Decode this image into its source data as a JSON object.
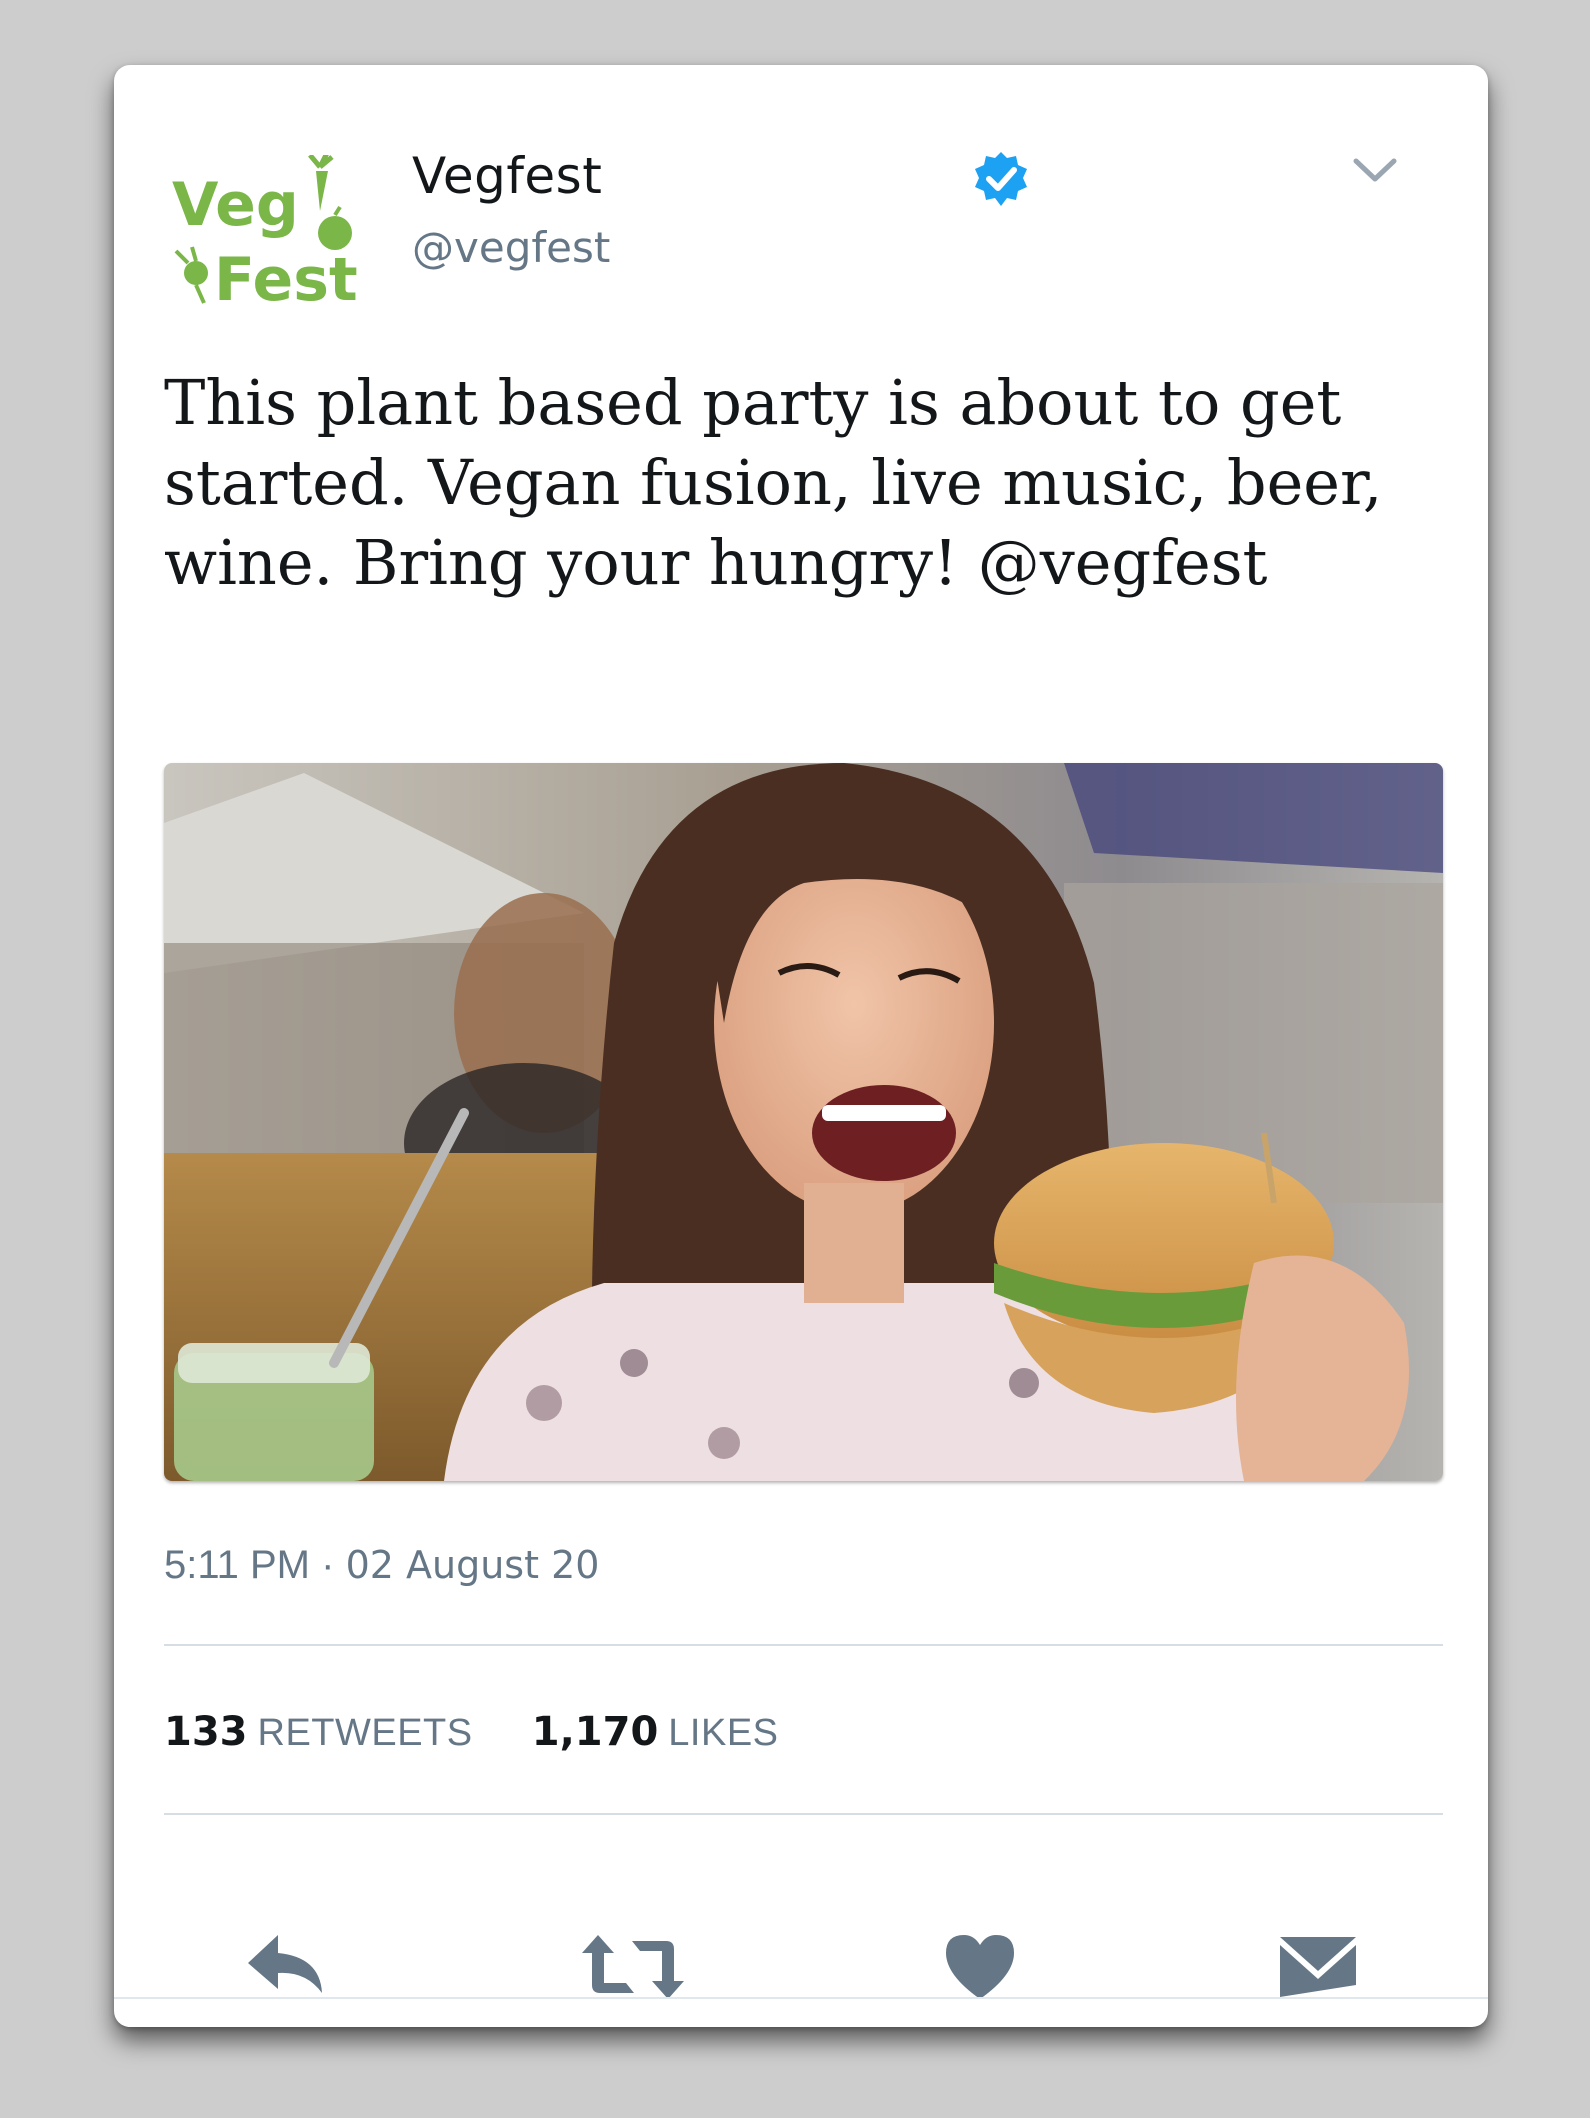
{
  "account": {
    "display_name": "Vegfest",
    "handle": "@vegfest",
    "logo_text_line1": "Veg",
    "logo_text_line2": "Fest",
    "verified": true
  },
  "tweet": {
    "text": "This plant based party is about to get started. Vegan fusion, live music, beer, wine. Bring your hungry! @vegfest",
    "time": "5:11 PM",
    "separator": "·",
    "date": "02 August 20"
  },
  "stats": {
    "retweets_count": "133",
    "retweets_label": "RETWEETS",
    "likes_count": "1,170",
    "likes_label": "LIKES"
  },
  "actions": {
    "reply_icon": "reply-icon",
    "retweet_icon": "retweet-icon",
    "like_icon": "heart-icon",
    "message_icon": "envelope-icon"
  },
  "colors": {
    "brand_green": "#7ab648",
    "verified_blue": "#1da1f2",
    "text_primary": "#14171a",
    "text_secondary": "#657786",
    "icon_gray": "#657786",
    "background": "#cdcdcd"
  }
}
